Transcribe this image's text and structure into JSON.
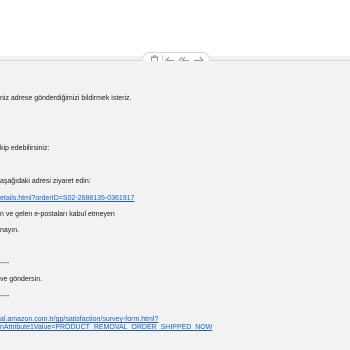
{
  "toolbar": {
    "buttons": [
      {
        "name": "trash-icon",
        "label": "Delete"
      },
      {
        "name": "reply-icon",
        "label": "Reply"
      },
      {
        "name": "reply-all-icon",
        "label": "Reply All"
      },
      {
        "name": "forward-icon",
        "label": "Forward"
      }
    ]
  },
  "email": {
    "line1": "niz adrese gönderdiğimizi bildirmek isteriz.",
    "line2": "kip edebilirsiniz:",
    "line3": "aşağıdaki adresi ziyaret edin:",
    "line4_link": "etails.html?orderID=S02-2688135-0361917",
    "line5": "n ve gelen e-postaları kabul etmeyen",
    "line6": "nayın.",
    "sep1": "----",
    "line7": "ve göndersin.",
    "sep2": "----",
    "line8_link": "al.amazon.com.tr/gp/satisfaction/survey-form.html?",
    "line9_link": "nAttribute1Value=PRODUCT_REMOVAL_ORDER_SHIPPED_NOW"
  },
  "colors": {
    "link": "#1a5fd0",
    "text": "#1c1c1c",
    "background": "#f2f2f2"
  }
}
